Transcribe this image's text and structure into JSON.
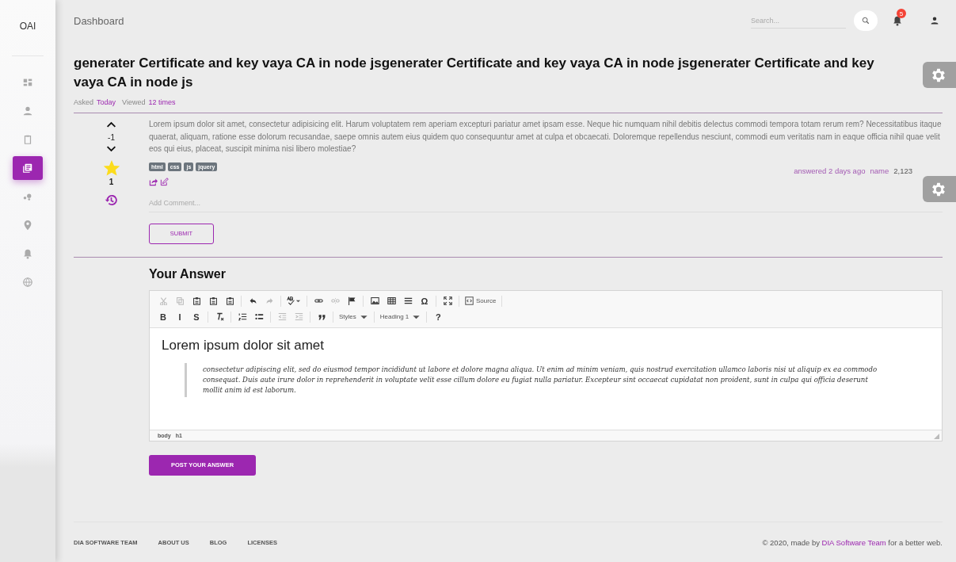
{
  "sidebar": {
    "logo": "OAI",
    "items": [
      {
        "kind": "dashboard",
        "selected": false
      },
      {
        "kind": "person",
        "selected": false
      },
      {
        "kind": "clipboard",
        "selected": false
      },
      {
        "kind": "articles",
        "selected": true
      },
      {
        "kind": "bubbles",
        "selected": false
      },
      {
        "kind": "location",
        "selected": false
      },
      {
        "kind": "bell",
        "selected": false
      },
      {
        "kind": "globe",
        "selected": false
      }
    ]
  },
  "header": {
    "title": "Dashboard",
    "search": {
      "placeholder": "Search..."
    },
    "notifications": {
      "count": "5"
    }
  },
  "question": {
    "title": "generater Certificate and key vaya CA in node jsgenerater Certificate and key vaya CA in node jsgenerater Certificate and key vaya CA in node js",
    "meta": [
      {
        "label": "Asked",
        "value": "Today"
      },
      {
        "label": "Viewed",
        "value": "12 times"
      }
    ],
    "score": "-1",
    "favorited": true,
    "favorites": "1",
    "body": "Lorem ipsum dolor sit amet, consectetur adipisicing elit. Harum voluptatem rem aperiam excepturi pariatur amet ipsam esse. Neque hic numquam nihil debitis delectus commodi tempora totam rerum rem? Necessitatibus itaque quaerat, aliquam, ratione esse dolorum recusandae, saepe omnis autem eius quidem quo consequuntur amet at culpa et obcaecati. Doloremque repellendus nesciunt, commodi eum veritatis nam in eaque officia nihil quae velit eos qui eius, placeat, suscipit minima nisi libero molestiae?",
    "tags": [
      "html",
      "css",
      "js",
      "jquery"
    ],
    "answered": "answered 2 days ago",
    "author": "name",
    "reputation": "2,123",
    "comment": {
      "placeholder": "Add Comment..."
    },
    "submit": "SUBMIT"
  },
  "answer": {
    "heading": "Your Answer",
    "toolbar": [
      [
        {
          "kind": "cut",
          "disabled": true
        },
        {
          "kind": "copy",
          "disabled": true
        },
        {
          "kind": "paste",
          "disabled": false
        },
        {
          "kind": "paste",
          "disabled": false
        },
        {
          "kind": "paste",
          "disabled": false
        },
        {
          "kind": "separator"
        },
        {
          "kind": "undo",
          "disabled": false
        },
        {
          "kind": "redo",
          "disabled": true
        },
        {
          "kind": "separator"
        },
        {
          "kind": "spellcheck",
          "disabled": false
        },
        {
          "kind": "separator"
        },
        {
          "kind": "link",
          "disabled": false
        },
        {
          "kind": "unlink",
          "disabled": true
        },
        {
          "kind": "anchor",
          "disabled": false
        },
        {
          "kind": "separator"
        },
        {
          "kind": "image",
          "disabled": false
        },
        {
          "kind": "table",
          "disabled": false
        },
        {
          "kind": "rule",
          "disabled": false
        },
        {
          "kind": "char",
          "label": "Ω",
          "disabled": false
        },
        {
          "kind": "separator"
        },
        {
          "kind": "maximize",
          "disabled": false
        },
        {
          "kind": "separator"
        },
        {
          "kind": "source",
          "label": "Source",
          "disabled": false
        },
        {
          "kind": "separator"
        }
      ],
      [
        {
          "kind": "char",
          "label": "B",
          "disabled": false
        },
        {
          "kind": "char",
          "label": "I",
          "disabled": false
        },
        {
          "kind": "char",
          "label": "S",
          "disabled": false
        },
        {
          "kind": "separator"
        },
        {
          "kind": "clear",
          "disabled": false
        },
        {
          "kind": "separator"
        },
        {
          "kind": "numbered",
          "disabled": false
        },
        {
          "kind": "bulleted",
          "disabled": false
        },
        {
          "kind": "separator"
        },
        {
          "kind": "outdent",
          "disabled": true
        },
        {
          "kind": "indent",
          "disabled": true
        },
        {
          "kind": "separator"
        },
        {
          "kind": "quote",
          "disabled": false
        },
        {
          "kind": "separator"
        },
        {
          "kind": "dropdown",
          "label": "Styles",
          "disabled": false
        },
        {
          "kind": "separator"
        },
        {
          "kind": "dropdown",
          "label": "Heading 1",
          "disabled": false
        },
        {
          "kind": "separator"
        },
        {
          "kind": "char",
          "label": "?",
          "disabled": false
        }
      ]
    ],
    "content_heading": "Lorem ipsum dolor sit amet",
    "content_quote": "consectetur adipiscing elit, sed do eiusmod tempor incididunt ut labore et dolore magna aliqua. Ut enim ad minim veniam, quis nostrud exercitation ullamco laboris nisi ut aliquip ex ea commodo consequat. Duis aute irure dolor in reprehenderit in voluptate velit esse cillum dolore eu fugiat nulla pariatur. Excepteur sint occaecat cupidatat non proident, sunt in culpa qui officia deserunt mollit anim id est laborum.",
    "path": [
      "body",
      "h1"
    ],
    "post": "POST YOUR ANSWER"
  },
  "footer": {
    "links": [
      "DIA SOFTWARE TEAM",
      "ABOUT US",
      "BLOG",
      "LICENSES"
    ],
    "copyright": {
      "before": "© 2020, made by",
      "link": "DIA Software Team",
      "after": "for a better web."
    }
  }
}
